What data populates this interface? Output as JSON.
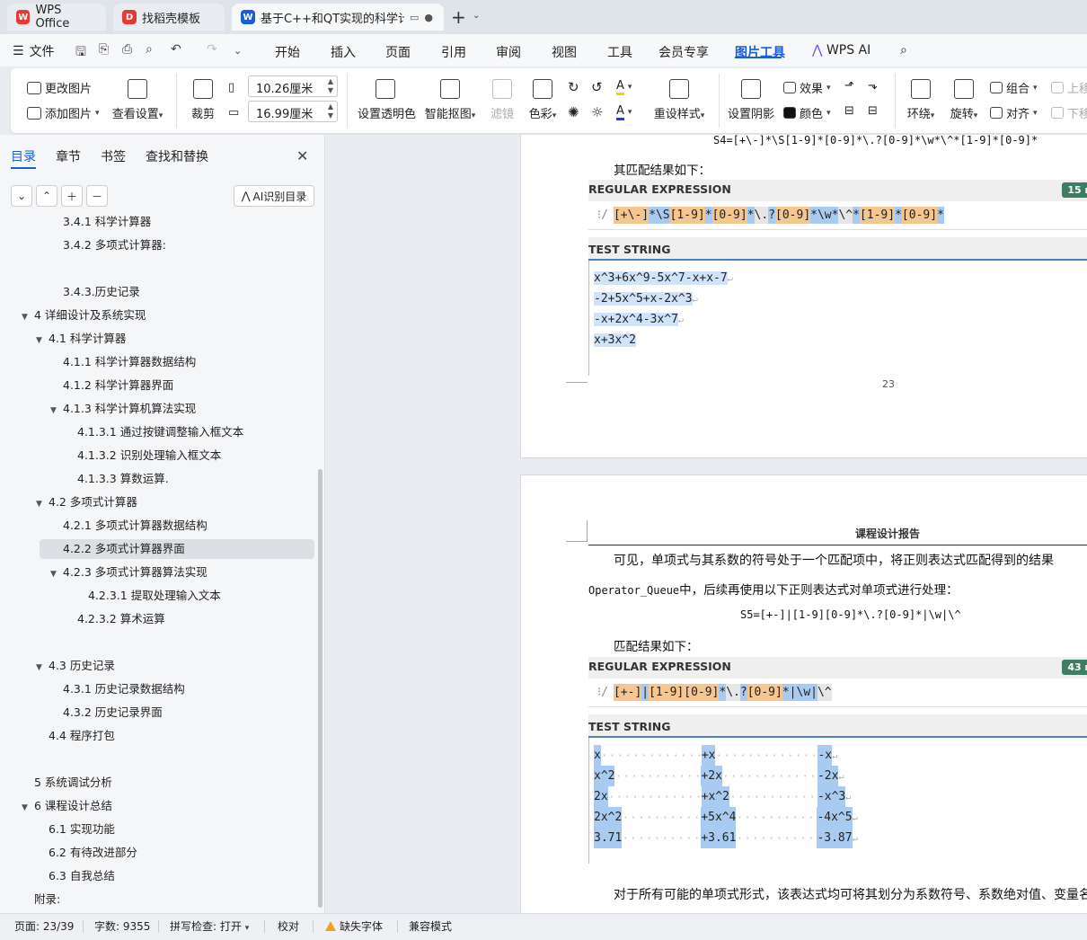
{
  "tabs": [
    {
      "label": "WPS Office",
      "color": "#e53935"
    },
    {
      "label": "找稻壳模板",
      "color": "#e53935"
    },
    {
      "label": "基于C++和QT实现的科学计算",
      "color": "#1a5dd6"
    }
  ],
  "menu": {
    "file": "文件",
    "items": [
      "开始",
      "插入",
      "页面",
      "引用",
      "审阅",
      "视图",
      "工具",
      "会员专享",
      "图片工具",
      "WPS AI"
    ],
    "active": "图片工具"
  },
  "ribbon": {
    "change_image": "更改图片",
    "add_image": "添加图片",
    "view_settings": "查看设置",
    "crop": "裁剪",
    "width_value": "10.26厘米",
    "height_value": "16.99厘米",
    "set_transparent": "设置透明色",
    "smart_cutout": "智能抠图",
    "filter": "滤镜",
    "color": "色彩",
    "reset_style": "重设样式",
    "set_shadow": "设置阴影",
    "effect": "效果",
    "fill_color": "颜色",
    "wrap": "环绕",
    "rotate": "旋转",
    "group": "组合",
    "align": "对齐",
    "move_up": "上移",
    "move_down": "下移"
  },
  "left_panel": {
    "tabs": [
      "目录",
      "章节",
      "书签",
      "查找和替换"
    ],
    "ai_toc": "AI识别目录",
    "toc": [
      {
        "label": "3.4.1  科学计算器",
        "level": 3,
        "tri": ""
      },
      {
        "label": "3.4.2 多项式计算器:",
        "level": 3,
        "tri": ""
      },
      {
        "label": "3.4.3.历史记录",
        "level": 3,
        "tri": ""
      },
      {
        "label": "4  详细设计及系统实现",
        "level": 1,
        "tri": "▼"
      },
      {
        "label": "4.1  科学计算器",
        "level": 2,
        "tri": "▼"
      },
      {
        "label": "4.1.1  科学计算器数据结构",
        "level": 3,
        "tri": ""
      },
      {
        "label": "4.1.2  科学计算器界面",
        "level": 3,
        "tri": ""
      },
      {
        "label": "4.1.3  科学计算机算法实现",
        "level": 3,
        "tri": "▼"
      },
      {
        "label": "4.1.3.1 通过按键调整输入框文本",
        "level": 4,
        "tri": ""
      },
      {
        "label": "4.1.3.2  识别处理输入框文本",
        "level": 4,
        "tri": ""
      },
      {
        "label": "4.1.3.3  算数运算.",
        "level": 4,
        "tri": ""
      },
      {
        "label": "4.2 多项式计算器",
        "level": 2,
        "tri": "▼"
      },
      {
        "label": "4.2.1  多项式计算器数据结构",
        "level": 3,
        "tri": ""
      },
      {
        "label": "4.2.2  多项式计算器界面",
        "level": 3,
        "tri": ""
      },
      {
        "label": "4.2.3 多项式计算器算法实现",
        "level": 3,
        "tri": "▼"
      },
      {
        "label": "4.2.3.1    提取处理输入文本",
        "level": 5,
        "tri": ""
      },
      {
        "label": "4.2.3.2  算术运算",
        "level": 4,
        "tri": ""
      },
      {
        "label": "4.3    历史记录",
        "level": 2,
        "tri": "▼"
      },
      {
        "label": "4.3.1  历史记录数据结构",
        "level": 3,
        "tri": ""
      },
      {
        "label": "4.3.2  历史记录界面",
        "level": 3,
        "tri": ""
      },
      {
        "label": "4.4  程序打包",
        "level": 2,
        "tri": ""
      },
      {
        "label": "5  系统调试分析",
        "level": 1,
        "tri": ""
      },
      {
        "label": "6  课程设计总结",
        "level": 1,
        "tri": "▼"
      },
      {
        "label": "6.1 实现功能",
        "level": 2,
        "tri": ""
      },
      {
        "label": "6.2 有待改进部分",
        "level": 2,
        "tri": ""
      },
      {
        "label": "6.3 自我总结",
        "level": 2,
        "tri": ""
      },
      {
        "label": "附录:",
        "level": 1,
        "tri": ""
      }
    ],
    "selected_index": 13
  },
  "document": {
    "page1": {
      "formula_s4": "S4=[+\\-]*\\S[1-9]*[0-9]*\\.?[0-9]*\\w*\\^*[1-9]*[0-9]*",
      "match_text": "其匹配结果如下：",
      "regex_label": "REGULAR EXPRESSION",
      "badge": "15 m",
      "test_label": "TEST STRING",
      "lines": [
        "x^3+6x^9-5x^7-x+x-7",
        "-2+5x^5+x-2x^3",
        "-x+2x^4-3x^7",
        "x+3x^2"
      ],
      "page_number": "23"
    },
    "page2": {
      "header": "课程设计报告",
      "para1": "可见，单项式与其系数的符号处于一个匹配项中，将正则表达式匹配得到的结果",
      "para2_code": "Operator_Queue",
      "para2_rest": "中，后续再使用以下正则表达式对单项式进行处理：",
      "formula_s5": "S5=[+-]|[1-9][0-9]*\\.?[0-9]*|\\w|\\^",
      "match_text": "匹配结果如下：",
      "regex_label": "REGULAR EXPRESSION",
      "badge": "43 m",
      "test_label": "TEST STRING",
      "rows": [
        [
          "x",
          "+x",
          "-x"
        ],
        [
          "x^2",
          "+2x",
          "-2x"
        ],
        [
          "2x",
          "+x^2",
          "-x^3"
        ],
        [
          "2x^2",
          "+5x^4",
          "-4x^5"
        ],
        [
          "3.71",
          "+3.61",
          "-3.87"
        ]
      ],
      "para3": "对于所有可能的单项式形式，该表达式均可将其划分为系数符号、系数绝对值、变量名"
    }
  },
  "statusbar": {
    "page": "页面: 23/39",
    "words": "字数: 9355",
    "spell": "拼写检查: 打开",
    "proof": "校对",
    "missing_font": "缺失字体",
    "compat": "兼容模式"
  }
}
